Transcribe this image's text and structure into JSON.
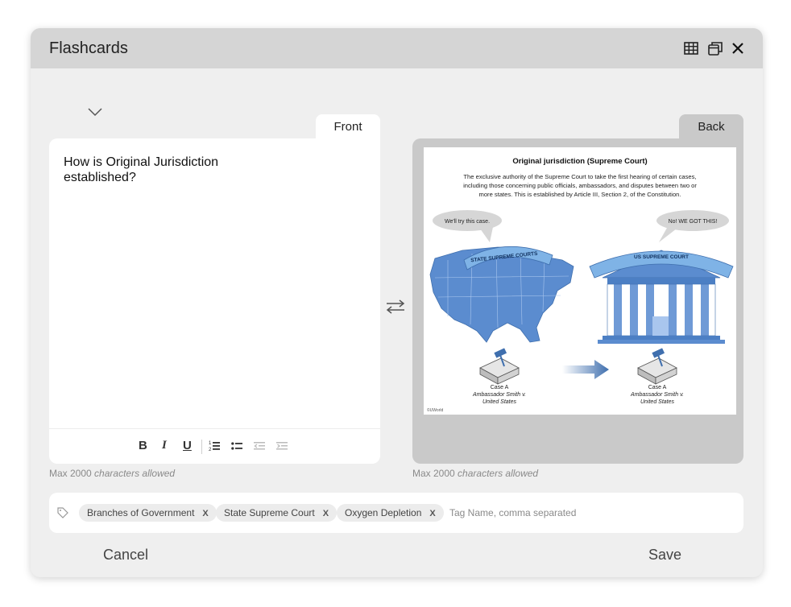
{
  "window": {
    "title": "Flashcards",
    "icons": [
      "grid-icon",
      "popout-window-icon",
      "close-icon"
    ]
  },
  "tabs": {
    "front": "Front",
    "back": "Back"
  },
  "front": {
    "text": "How is Original Jurisdiction established?",
    "char_limit_prefix": "Max 2000 ",
    "char_limit_suffix": "characters allowed"
  },
  "toolbar": {
    "bold": "B",
    "italic": "I",
    "underline": "U"
  },
  "back": {
    "char_limit_prefix": "Max 2000 ",
    "char_limit_suffix": "characters allowed",
    "image": {
      "title": "Original jurisdiction (Supreme Court)",
      "description_lines": [
        "The exclusive authority of the Supreme Court to take the first hearing of certain cases,",
        "including those concerning public officials, ambassadors, and disputes between two or",
        "more states. This is established by Article III, Section 2, of the Constitution."
      ],
      "bubble_left": "We'll try this case.",
      "bubble_right": "No! WE GOT THIS!",
      "banner_left": "STATE SUPREME COURTS",
      "banner_right": "US SUPREME COURT",
      "case_left": {
        "line1": "Case A",
        "line2": "Ambassador Smith v.",
        "line3": "United States"
      },
      "case_right": {
        "line1": "Case A",
        "line2": "Ambassador Smith v.",
        "line3": "United States"
      },
      "credit": "©UWorld",
      "colors": {
        "blue": "#5b8ccf",
        "banner": "#7fb3e6",
        "dark_blue": "#3f6fae"
      }
    }
  },
  "tags": {
    "items": [
      {
        "label": "Branches of Government",
        "remove": "X"
      },
      {
        "label": "State Supreme Court",
        "remove": "X"
      },
      {
        "label": "Oxygen Depletion",
        "remove": "X"
      }
    ],
    "placeholder": "Tag Name, comma separated"
  },
  "actions": {
    "cancel": "Cancel",
    "save": "Save"
  }
}
